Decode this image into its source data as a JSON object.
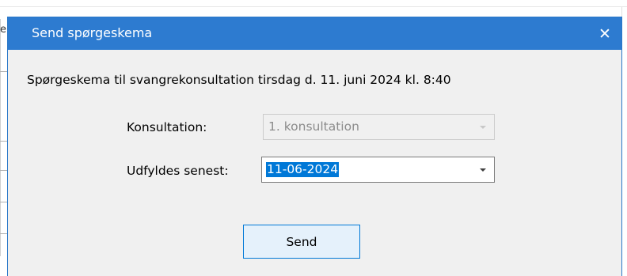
{
  "window": {
    "title": "Send spørgeskema",
    "close_glyph": "✕"
  },
  "background": {
    "stub_text": "e"
  },
  "description": "Spørgeskema til svangrekonsultation tirsdag d. 11. juni 2024 kl. 8:40",
  "form": {
    "konsultation": {
      "label": "Konsultation:",
      "value": "1. konsultation",
      "enabled": false
    },
    "udfyldes": {
      "label": "Udfyldes senest:",
      "value": "11-06-2024",
      "selected": true
    }
  },
  "actions": {
    "send_label": "Send"
  },
  "colors": {
    "titlebar": "#2d7bd0",
    "selection": "#0078d7",
    "button_border": "#0078d7"
  }
}
